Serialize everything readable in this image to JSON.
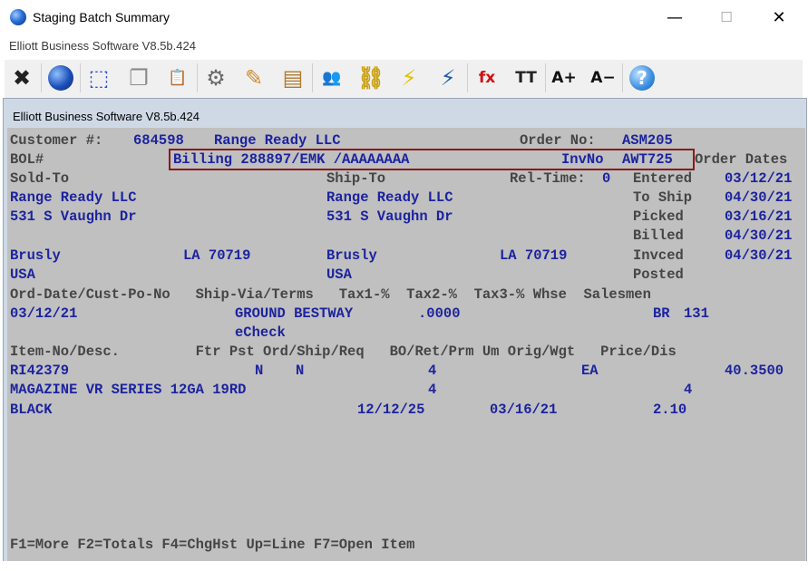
{
  "window": {
    "title": "Staging Batch Summary",
    "subtitle": "Elliott Business Software V8.5b.424",
    "minimize": "—",
    "maximize": "☐",
    "close": "✕"
  },
  "toolbar": {
    "items": [
      {
        "name": "close-x-icon",
        "glyph": "✖",
        "color": "#222222"
      },
      {
        "name": "globe-icon",
        "glyph": "●",
        "color": "#1d4fb8"
      },
      {
        "name": "select-box-icon",
        "glyph": "⬚",
        "color": "#2a4fd0"
      },
      {
        "name": "copy-icon",
        "glyph": "❐",
        "color": "#8a8a8a"
      },
      {
        "name": "paste-icon",
        "glyph": "📋",
        "color": "#8a8a8a"
      },
      {
        "name": "settings-gear-icon",
        "glyph": "⚙",
        "color": "#6a6a6a"
      },
      {
        "name": "edit-pencil-icon",
        "glyph": "✎",
        "color": "#d08a2a"
      },
      {
        "name": "notepad-icon",
        "glyph": "▤",
        "color": "#b07a30"
      },
      {
        "name": "users-icon",
        "glyph": "👥",
        "color": "#2f8a4a"
      },
      {
        "name": "link-chain-icon",
        "glyph": "⛓",
        "color": "#c9a012"
      },
      {
        "name": "lightning-icon",
        "glyph": "⚡",
        "color": "#e0c000"
      },
      {
        "name": "window-lightning-icon",
        "glyph": "⚡",
        "color": "#1f5fa8"
      },
      {
        "name": "function-fx-icon",
        "glyph": "fx",
        "color": "#d01010"
      },
      {
        "name": "text-size-icon",
        "glyph": "TT",
        "color": "#222222"
      },
      {
        "name": "font-increase-icon",
        "glyph": "A+",
        "color": "#111111"
      },
      {
        "name": "font-decrease-icon",
        "glyph": "A−",
        "color": "#111111"
      },
      {
        "name": "help-icon",
        "glyph": "?",
        "color": "#2f7fd8"
      }
    ]
  },
  "inner_window_title": "Elliott Business Software V8.5b.424",
  "screen": {
    "row1": {
      "customer_label": "Customer #:",
      "customer_no": "684598",
      "customer_name": "Range Ready LLC",
      "order_label": "Order No:",
      "order_no": "ASM205"
    },
    "row2": {
      "bol_label": "BOL#",
      "billing": "Billing 288897/EMK /AAAAAAAA",
      "invno_label": "InvNo",
      "invno": "AWT725",
      "order_dates_label": "Order Dates"
    },
    "row3": {
      "sold_to_label": "Sold-To",
      "ship_to_label": "Ship-To",
      "rel_time_label": "Rel-Time:",
      "rel_time": "0",
      "entered_label": "Entered",
      "entered": "03/12/21"
    },
    "row4": {
      "sold_name": "Range Ready LLC",
      "ship_name": "Range Ready LLC",
      "to_ship_label": "To Ship",
      "to_ship": "04/30/21"
    },
    "row5": {
      "sold_addr": "531 S Vaughn Dr",
      "ship_addr": "531 S Vaughn Dr",
      "picked_label": "Picked",
      "picked": "03/16/21"
    },
    "row6": {
      "billed_label": "Billed",
      "billed": "04/30/21"
    },
    "row7": {
      "sold_city": "Brusly",
      "sold_state_zip": "LA 70719",
      "ship_city": "Brusly",
      "ship_state_zip": "LA 70719",
      "invced_label": "Invced",
      "invced": "04/30/21"
    },
    "row8": {
      "sold_country": "USA",
      "ship_country": "USA",
      "posted_label": "Posted"
    },
    "row9": {
      "header": "Ord-Date/Cust-Po-No   Ship-Via/Terms   Tax1-%  Tax2-%  Tax3-% Whse  Salesmen"
    },
    "row10": {
      "ord_date": "03/12/21",
      "ship_via": "GROUND BESTWAY",
      "tax1": ".0000",
      "whse": "BR",
      "salesman": "131"
    },
    "row11": {
      "terms": "eCheck"
    },
    "row12": {
      "header": "Item-No/Desc.         Ftr Pst Ord/Ship/Req   BO/Ret/Prm Um Orig/Wgt   Price/Dis"
    },
    "row13": {
      "item_no": "RI42379",
      "ftr": "N",
      "pst": "N",
      "ord": "4",
      "um": "EA",
      "price": "40.3500"
    },
    "row14": {
      "desc": "MAGAZINE VR SERIES 12GA 19RD",
      "ship": "4",
      "orig": "4"
    },
    "row15": {
      "desc2": "BLACK",
      "req": "12/12/25",
      "prm": "03/16/21",
      "wgt": "2.10"
    },
    "footer": "F1=More F2=Totals F4=ChgHst Up=Line F7=Open Item"
  }
}
